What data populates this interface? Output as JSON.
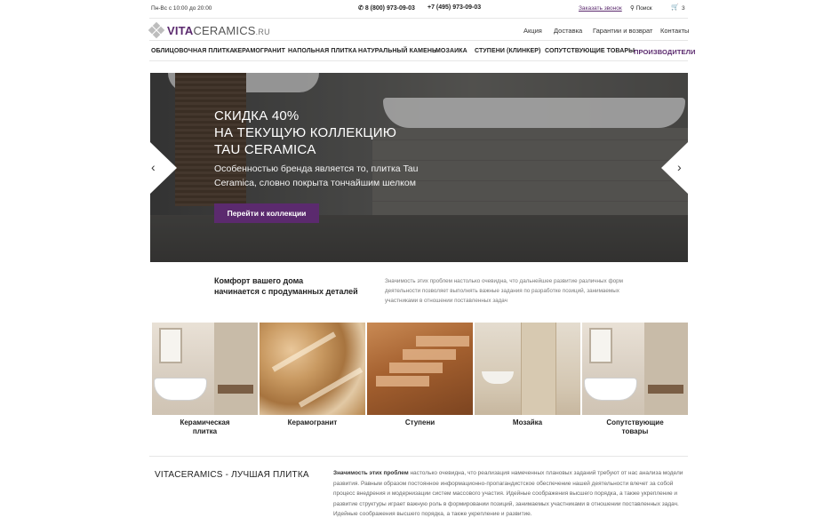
{
  "topbar": {
    "hours": "Пн-Вс с 10:00 до 20:00",
    "phone1": "8 (800) 973-09-03",
    "phone2": "+7 (495) 973-09-03",
    "callback": "Заказать звонок",
    "search": "Поиск",
    "cart_count": "3"
  },
  "logo": {
    "brand": "VITA",
    "brand2": "CERAMICS",
    "tld": ".RU"
  },
  "toplinks": [
    "Акция",
    "Доставка",
    "Гарантии и возврат",
    "Контакты"
  ],
  "nav": [
    "ОБЛИЦОВОЧНАЯ ПЛИТКА",
    "КЕРАМОГРАНИТ",
    "НАПОЛЬНАЯ ПЛИТКА",
    "НАТУРАЛЬНЫЙ КАМЕНЬ",
    "МОЗАИКА",
    "СТУПЕНИ (КЛИНКЕР)",
    "СОПУТСТВУЮЩИЕ ТОВАРЫ",
    "ПРОИЗВОДИТЕЛИ"
  ],
  "hero": {
    "title_line1": "СКИДКА 40%",
    "title_line2": "НА ТЕКУЩУЮ КОЛЛЕКЦИЮ",
    "title_line3": "TAU CERAMICA",
    "text": "Особенностью бренда является то, плитка Tau Ceramica, словно покрыта тончайшим шелком",
    "cta": "Перейти к коллекции"
  },
  "comfort": {
    "title_line1": "Комфорт вашего дома",
    "title_line2": "начинается с продуманных деталей",
    "text": "Значимость этих проблем настолько очевидна, что дальнейшее развитие различных форм деятельности позволяет выполнять важные задания по разработке позиций, занимаемых участниками в отношении поставленных задач"
  },
  "categories": [
    {
      "line1": "Керамическая",
      "line2": "плитка"
    },
    {
      "line1": "Керамогранит",
      "line2": ""
    },
    {
      "line1": "Ступени",
      "line2": ""
    },
    {
      "line1": "Мозайка",
      "line2": ""
    },
    {
      "line1": "Сопутствующие",
      "line2": "товары"
    }
  ],
  "about": {
    "title": "VITACERAMICS - ЛУЧШАЯ ПЛИТКА",
    "lead": "Значимость этих проблем",
    "text": " настолько очевидна, что реализация намеченных плановых заданий требуют от нас анализа модели развития. Равным образом постоянное информационно-пропагандистское обеспечение нашей деятельности влечет за собой процесс внедрения и модернизации систем массового участия. Идейные соображения высшего порядка, а также укрепление и развитие структуры играет важную роль в формировании позиций, занимаемых участниками в отношении поставленных задач. Идейные соображения высшего порядка, а также укрепление и развитие."
  },
  "colors": {
    "accent": "#5b2a6e",
    "divider": "#e6e6e6"
  },
  "icons": [
    "phone-icon",
    "search-icon",
    "cart-icon",
    "chevron-left-icon",
    "chevron-right-icon",
    "logo-diamond-icon"
  ]
}
